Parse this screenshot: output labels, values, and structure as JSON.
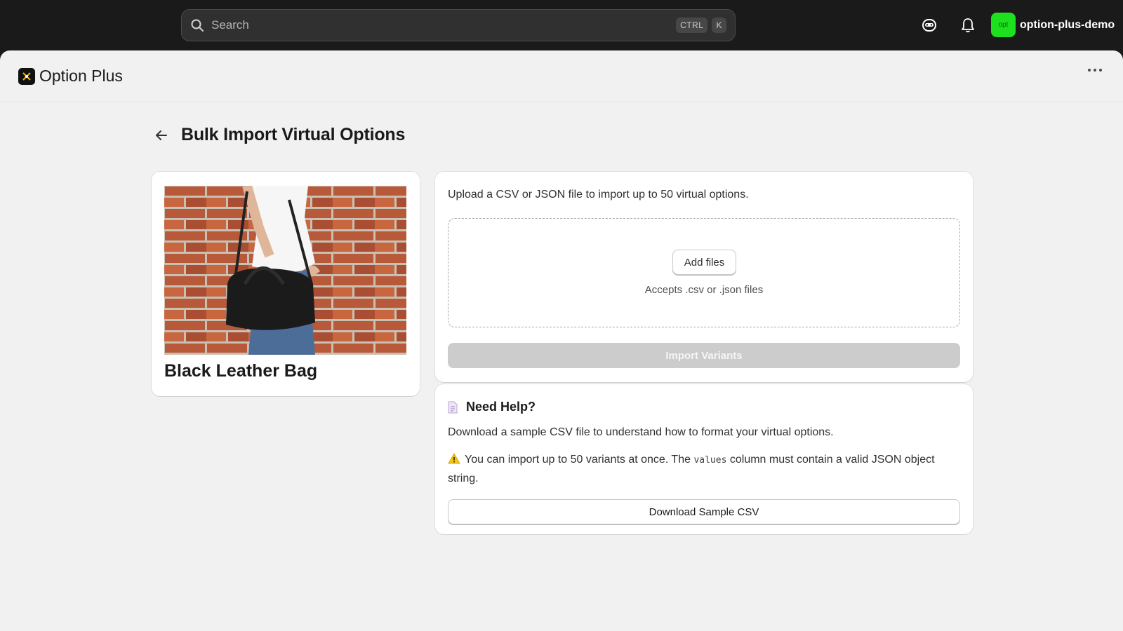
{
  "topbar": {
    "search_placeholder": "Search",
    "shortcut_keys": [
      "CTRL",
      "K"
    ],
    "icons": [
      "search-icon",
      "sidekick-icon",
      "bell-icon"
    ],
    "user": {
      "avatar_text": "opt",
      "avatar_color": "#1ee11e",
      "name": "option-plus-demo"
    }
  },
  "app": {
    "title": "Option Plus"
  },
  "page": {
    "title": "Bulk Import Virtual Options"
  },
  "product": {
    "name": "Black Leather Bag",
    "image_alt": "Black Leather Bag"
  },
  "upload": {
    "description": "Upload a CSV or JSON file to import up to 50 virtual options.",
    "add_files_label": "Add files",
    "accepts_text": "Accepts .csv or .json files",
    "import_label": "Import Variants",
    "import_disabled": true
  },
  "help": {
    "title": "Need Help?",
    "description": "Download a sample CSV file to understand how to format your virtual options.",
    "warning_prefix": "You can import up to 50 variants at once. The",
    "warning_code": "values",
    "warning_suffix": "column must contain a valid JSON object string.",
    "download_label": "Download Sample CSV"
  }
}
